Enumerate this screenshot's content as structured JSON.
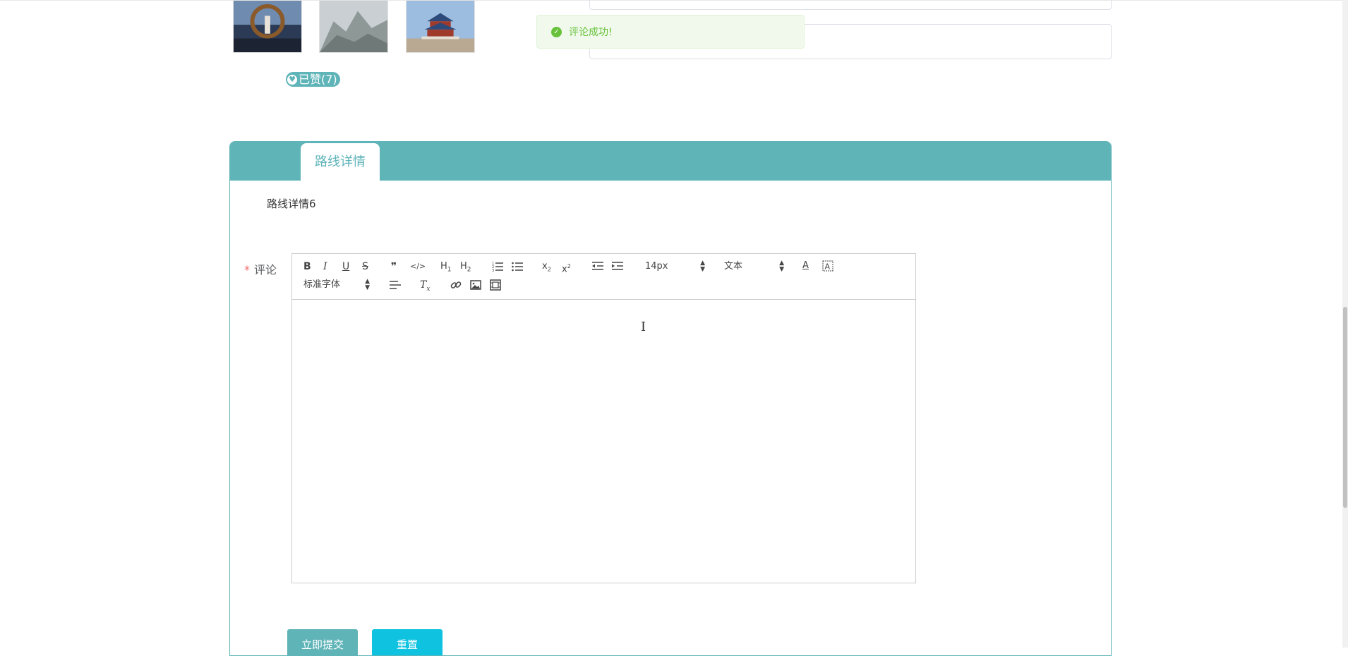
{
  "gallery": {
    "like_badge": "已赞(7)",
    "like_count": 7
  },
  "toast": {
    "message": "评论成功!",
    "type": "success",
    "color": "#67c23a"
  },
  "panel": {
    "tab_label": "路线详情",
    "detail_text": "路线详情6",
    "accent_color": "#5fb4b8"
  },
  "comment_form": {
    "label": "评论",
    "required_mark": "*",
    "editor": {
      "font_size_select": "14px",
      "header_select": "文本",
      "font_family_select": "标准字体",
      "toolbar_icons": [
        "bold-icon",
        "italic-icon",
        "underline-icon",
        "strike-icon",
        "blockquote-icon",
        "code-block-icon",
        "h1-icon",
        "h2-icon",
        "ordered-list-icon",
        "bullet-list-icon",
        "subscript-icon",
        "superscript-icon",
        "outdent-icon",
        "indent-icon",
        "font-color-icon",
        "background-color-icon",
        "align-icon",
        "clean-format-icon",
        "link-icon",
        "image-icon",
        "video-icon"
      ],
      "content": ""
    },
    "submit_label": "立即提交",
    "reset_label": "重置",
    "submit_color": "#5fb4b8",
    "reset_color": "#0fc3e0"
  }
}
